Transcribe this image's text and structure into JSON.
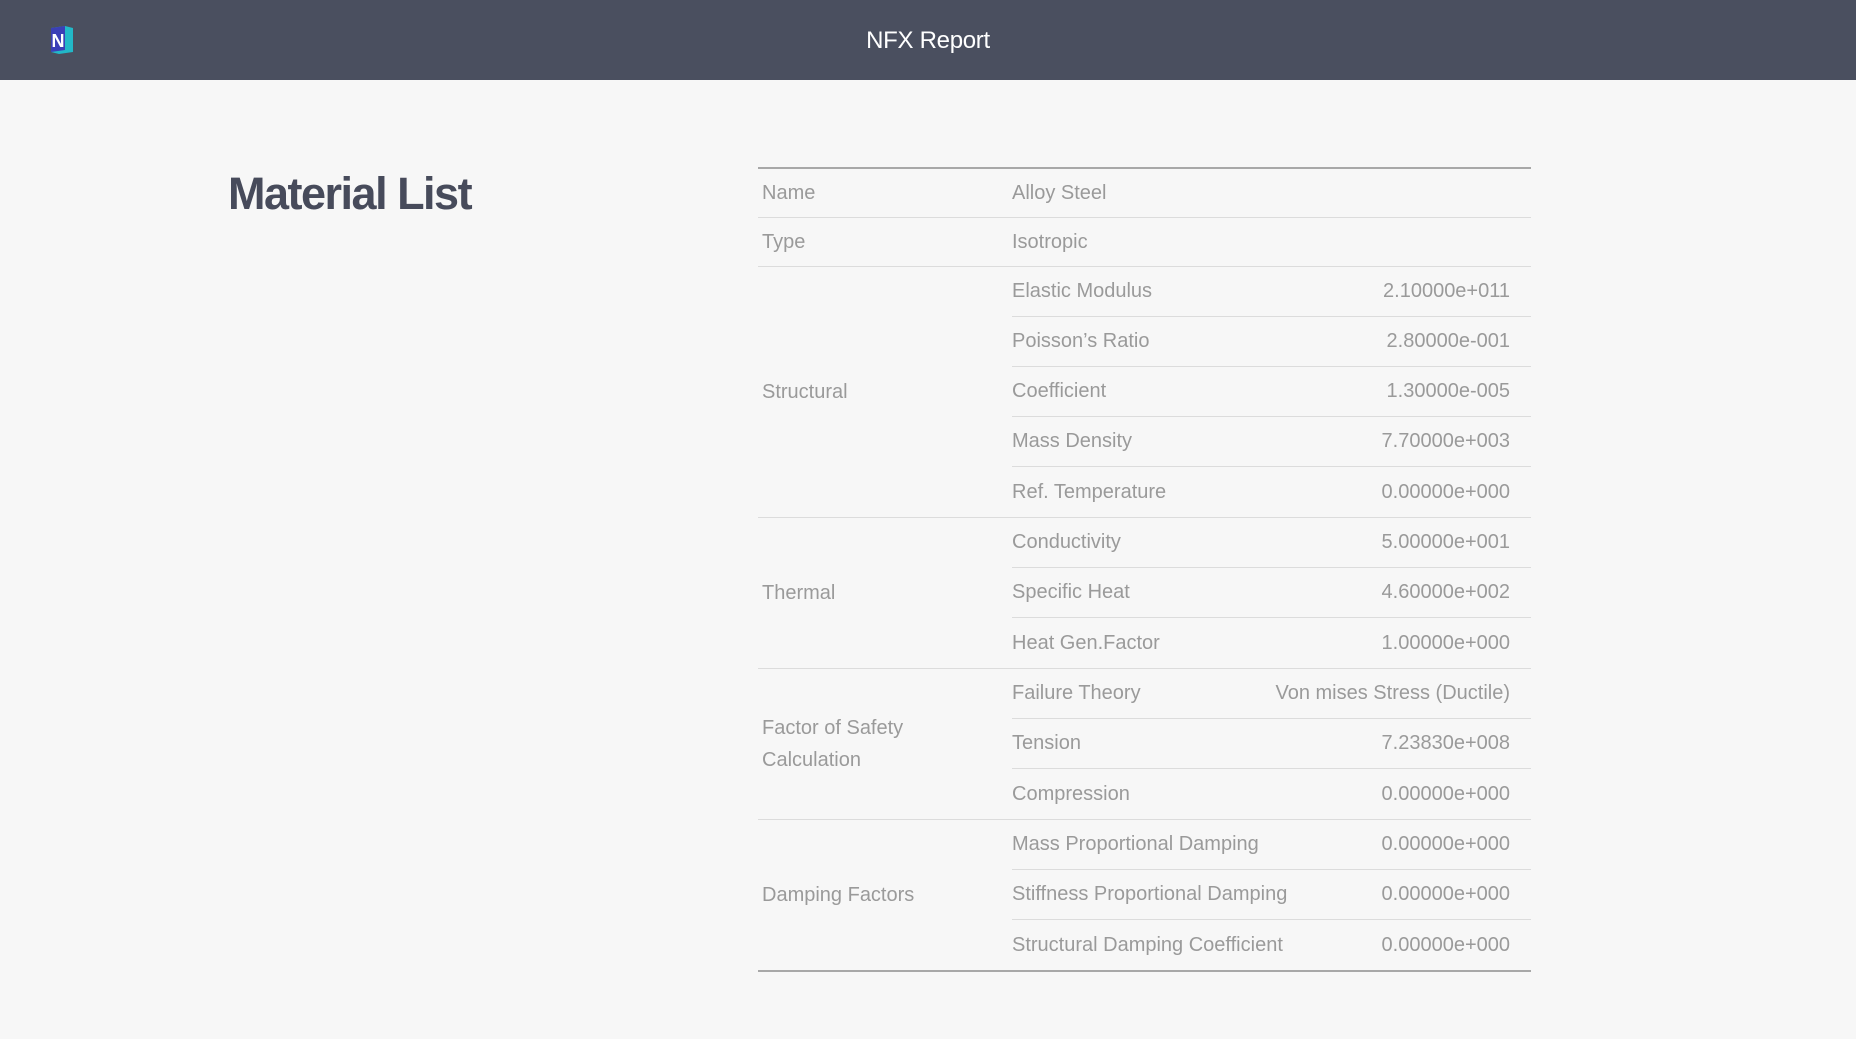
{
  "header": {
    "title": "NFX Report",
    "logo_letter": "N"
  },
  "page": {
    "title": "Material List"
  },
  "material": {
    "name_label": "Name",
    "name_value": "Alloy Steel",
    "type_label": "Type",
    "type_value": "Isotropic",
    "groups": [
      {
        "label": "Structural",
        "properties": [
          {
            "name": "Elastic Modulus",
            "value": "2.10000e+011"
          },
          {
            "name": "Poisson’s Ratio",
            "value": "2.80000e-001"
          },
          {
            "name": "Coefficient",
            "value": "1.30000e-005"
          },
          {
            "name": "Mass Density",
            "value": "7.70000e+003"
          },
          {
            "name": "Ref. Temperature",
            "value": "0.00000e+000"
          }
        ]
      },
      {
        "label": "Thermal",
        "properties": [
          {
            "name": "Conductivity",
            "value": "5.00000e+001"
          },
          {
            "name": "Specific Heat",
            "value": "4.60000e+002"
          },
          {
            "name": "Heat Gen.Factor",
            "value": "1.00000e+000"
          }
        ]
      },
      {
        "label": "Factor of Safety Calculation",
        "properties": [
          {
            "name": "Failure Theory",
            "value": "Von mises Stress (Ductile)"
          },
          {
            "name": "Tension",
            "value": "7.23830e+008"
          },
          {
            "name": "Compression",
            "value": "0.00000e+000"
          }
        ]
      },
      {
        "label": "Damping Factors",
        "properties": [
          {
            "name": "Mass Proportional Damping",
            "value": "0.00000e+000"
          },
          {
            "name": "Stiffness Proportional Damping",
            "value": "0.00000e+000"
          },
          {
            "name": "Structural Damping Coefficient",
            "value": "0.00000e+000"
          }
        ]
      }
    ]
  },
  "colors": {
    "header_bg": "#4a4f5f",
    "page_bg": "#f7f7f7",
    "title_text": "#474b5b",
    "table_text": "#9a9a9a",
    "logo_primary": "#3b3fb6",
    "logo_accent": "#22b8c8"
  }
}
